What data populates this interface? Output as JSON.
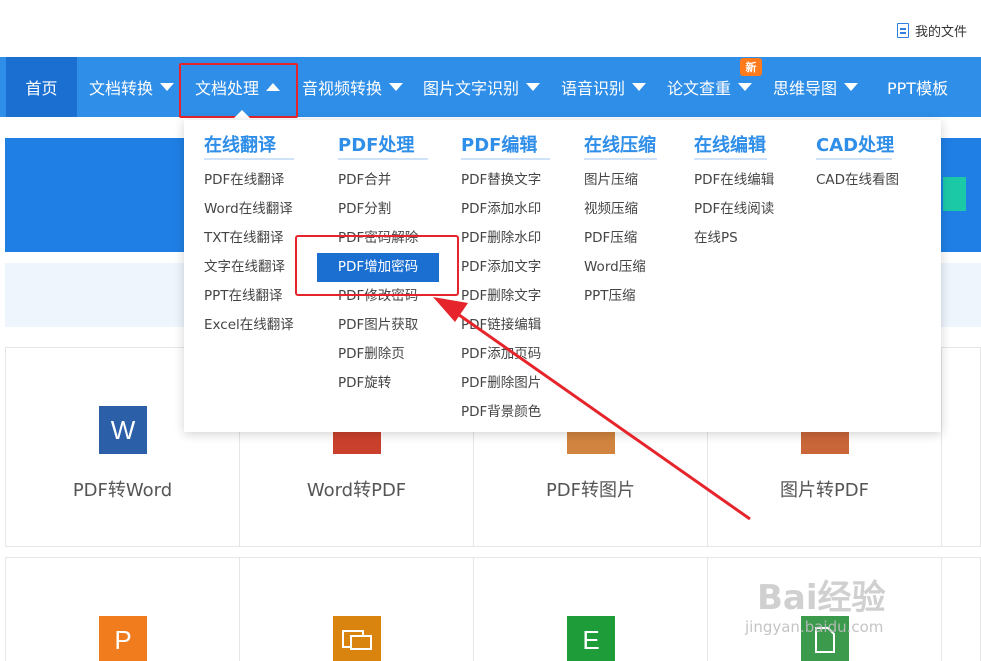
{
  "topbar": {
    "my_files": "我的文件",
    "my_files_icon": "document-list-icon"
  },
  "nav": {
    "items": [
      {
        "label": "首页"
      },
      {
        "label": "文档转换"
      },
      {
        "label": "文档处理"
      },
      {
        "label": "音视频转换"
      },
      {
        "label": "图片文字识别"
      },
      {
        "label": "语音识别"
      },
      {
        "label": "论文查重"
      },
      {
        "label": "思维导图"
      },
      {
        "label": "PPT模板"
      }
    ],
    "new_badge": "新",
    "active_index": 2
  },
  "dropdown": {
    "columns": [
      {
        "title": "在线翻译",
        "items": [
          "PDF在线翻译",
          "Word在线翻译",
          "TXT在线翻译",
          "文字在线翻译",
          "PPT在线翻译",
          "Excel在线翻译"
        ]
      },
      {
        "title": "PDF处理",
        "items": [
          "PDF合并",
          "PDF分割",
          "PDF密码解除",
          "PDF增加密码",
          "PDF修改密码",
          "PDF图片获取",
          "PDF删除页",
          "PDF旋转"
        ],
        "selected_index": 3
      },
      {
        "title": "PDF编辑",
        "items": [
          "PDF替换文字",
          "PDF添加水印",
          "PDF删除水印",
          "PDF添加文字",
          "PDF删除文字",
          "PDF链接编辑",
          "PDF添加页码",
          "PDF删除图片",
          "PDF背景颜色"
        ]
      },
      {
        "title": "在线压缩",
        "items": [
          "图片压缩",
          "视频压缩",
          "PDF压缩",
          "Word压缩",
          "PPT压缩"
        ]
      },
      {
        "title": "在线编辑",
        "items": [
          "PDF在线编辑",
          "PDF在线阅读",
          "在线PS"
        ]
      },
      {
        "title": "CAD处理",
        "items": [
          "CAD在线看图"
        ]
      }
    ]
  },
  "tiles": {
    "row1": [
      {
        "label": "PDF转Word",
        "icon": "word-icon",
        "glyph": "W",
        "color": "#2b5fa8"
      },
      {
        "label": "Word转PDF",
        "icon": "pdf-icon",
        "glyph": "",
        "color": "#c9412c"
      },
      {
        "label": "PDF转图片",
        "icon": "image-icon",
        "glyph": "",
        "color": "#d0843f"
      },
      {
        "label": "图片转PDF",
        "icon": "pdf-image-icon",
        "glyph": "",
        "color": "#c9663a"
      }
    ],
    "row2": [
      {
        "label": "",
        "icon": "ppt-icon",
        "glyph": "P",
        "color": "#f07c1e"
      },
      {
        "label": "",
        "icon": "pdf-to-ppt-icon",
        "glyph": "",
        "color": "#d9840f"
      },
      {
        "label": "",
        "icon": "excel-icon",
        "glyph": "E",
        "color": "#1f9c3a"
      },
      {
        "label": "",
        "icon": "pdf-doc-icon",
        "glyph": "",
        "color": "#3c9a4d"
      }
    ]
  },
  "watermark": {
    "main": "Bai经验",
    "sub": "jingyan.baidu.com"
  },
  "colors": {
    "nav_bg": "#2f8ee8",
    "accent": "#1b6fd1",
    "highlight": "#e5252b"
  }
}
